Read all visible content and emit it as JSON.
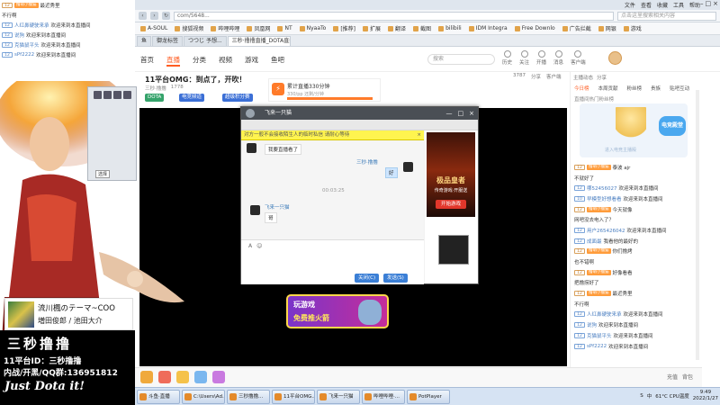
{
  "browser": {
    "menu": [
      "文件",
      "查看",
      "收藏",
      "工具",
      "帮助"
    ],
    "url": "com/5648...",
    "search_placeholder": "点击这里搜索相关内容",
    "bookmarks": [
      "A-SOUL",
      "搜狐视频",
      "哔哩哔哩",
      "凤凰网",
      "NT",
      "NyaaTo",
      "[推荐]",
      "扩展",
      "翻译",
      "截图",
      "bilibili",
      "IDM Integra",
      "Free Downlo",
      "广告拦截",
      "网银",
      "游戏"
    ],
    "tabs": [
      "鱼",
      "御龙标签",
      "つつじ 予想...",
      "三秒·撸撸直播_DOTA直播_斗..."
    ]
  },
  "site": {
    "nav": [
      "首页",
      "直播",
      "分类",
      "视频",
      "游戏",
      "鱼吧"
    ],
    "active_nav": "直播",
    "search_placeholder": "搜索",
    "header_icons": [
      "历史",
      "关注",
      "开播",
      "消息",
      "客户端"
    ]
  },
  "room": {
    "title": "11平台OMG：到点了，开吹！",
    "meta": [
      "三秒·撸撸",
      "1778"
    ],
    "buttons": [
      "DOTA",
      "电竞频道",
      "超级积分赛"
    ],
    "live_card": {
      "title": "累计直播330分钟",
      "sub": "330/pp 还剩/分钟"
    },
    "right_meta": [
      "3787",
      "分享",
      "客户端"
    ]
  },
  "chat_window": {
    "title": "飞来一只猫",
    "notice": "对方一般不会接收陌生人的临时私信 请耐心等待",
    "close_x": "×",
    "window_controls": [
      "—",
      "□",
      "×"
    ],
    "time": "00:03:25",
    "messages": [
      {
        "text": "我要直播看了",
        "mine": false
      },
      {
        "sender": "三秒·撸撸",
        "text": "好",
        "mine": true
      },
      {
        "sender": "飞来一只猫",
        "text": "哥",
        "mine": false
      }
    ],
    "input_tools": [
      "A",
      "☺"
    ],
    "btn_close": "关闭(C)",
    "btn_send": "发送(S)",
    "ad": {
      "title": "极品皇者",
      "subtitle": "传奇游戏·开服送",
      "cta": "开始游戏"
    }
  },
  "promo": {
    "line1": "玩游戏",
    "line2": "免费推火箭"
  },
  "right_panel": {
    "header": [
      "主播动态",
      "分享"
    ],
    "tabs": [
      "今日榜",
      "本周贡献",
      "粉丝榜",
      "贵族",
      "贴吧互动"
    ],
    "notice": "直播间热门粉丝榜",
    "banner_caption": "进入电竞主播殿",
    "banner_badge": "电竞殿堂",
    "chat": [
      {
        "lv": "12",
        "badge": "撸萌小撸猫",
        "user": "",
        "text": "泰波 ajr"
      },
      {
        "lv": "",
        "badge": "",
        "user": "",
        "text": "不就好了"
      },
      {
        "lv": "12",
        "badge": "",
        "user": "哪52456027",
        "text": "欢迎来到本直播间"
      },
      {
        "lv": "10",
        "badge": "",
        "user": "早模型好想看看",
        "text": "欢迎来到本直播间"
      },
      {
        "lv": "12",
        "badge": "撸萌小撸猫",
        "user": "",
        "text": "今天就像"
      },
      {
        "lv": "",
        "badge": "",
        "user": "",
        "text": "网吧没去电入了？"
      },
      {
        "lv": "12",
        "badge": "",
        "user": "用户265426042",
        "text": "欢迎来到本直播间"
      },
      {
        "lv": "12",
        "badge": "",
        "user": "成面最",
        "text": "我看他的最好的"
      },
      {
        "lv": "12",
        "badge": "撸萌小撸猫",
        "user": "",
        "text": "你们撸烤"
      },
      {
        "lv": "",
        "badge": "",
        "user": "",
        "text": "也不错啊"
      },
      {
        "lv": "12",
        "badge": "撸萌小撸猫",
        "user": "",
        "text": "好像看看"
      },
      {
        "lv": "",
        "badge": "",
        "user": "",
        "text": "把撸捞好了"
      },
      {
        "lv": "12",
        "badge": "撸萌小撸猫",
        "user": "",
        "text": "最近秀里"
      },
      {
        "lv": "",
        "badge": "",
        "user": "",
        "text": "不行啊"
      },
      {
        "lv": "12",
        "badge": "",
        "user": "人红鼻硬驶来承",
        "text": "欢迎来到本直播间"
      },
      {
        "lv": "12",
        "badge": "",
        "user": "说狗",
        "text": "欢迎来到本直播间"
      },
      {
        "lv": "12",
        "badge": "",
        "user": "克猫鼠平头",
        "text": "欢迎来到本直播间"
      },
      {
        "lv": "12",
        "badge": "",
        "user": "sPf2222",
        "text": "欢迎来到本直播间"
      }
    ]
  },
  "overlay": {
    "chat": [
      {
        "lv": "12",
        "badge": "撸萌小撸猫",
        "user": "",
        "text": "最近秀里"
      },
      {
        "lv": "",
        "badge": "",
        "user": "",
        "text": "不行啊"
      },
      {
        "lv": "12",
        "badge": "",
        "user": "人红鼻硬驶来承",
        "text": "欢迎来到本直播间"
      },
      {
        "lv": "12",
        "badge": "",
        "user": "说狗",
        "text": "欢迎来到本直播间"
      },
      {
        "lv": "12",
        "badge": "",
        "user": "克猫鼠平头",
        "text": "欢迎来到本直播间"
      },
      {
        "lv": "12",
        "badge": "",
        "user": "sPf2222",
        "text": "欢迎来到本直播间"
      }
    ],
    "panel_btn": "选择",
    "song": "流川楓のテーマ~COO",
    "artist": "増田俊郎 / 池田大介",
    "logo": "三秒撸撸",
    "platform_id": "11平台ID：三秒撸撸",
    "qq_group": "内战/开黑/QQ群:136951812",
    "slogan": "Just Dota it!"
  },
  "giftbar": {
    "right": [
      "充值",
      "背包"
    ]
  },
  "taskbar": {
    "items": [
      "斗鱼·直播",
      "C:\\Users\\Ad...",
      "三秒撸撸...",
      "11平台OMG...",
      "飞来一只猫",
      "哔哩哔哩·...",
      "PotPlayer"
    ],
    "clock_time": "9:49",
    "clock_date": "2022/1/27",
    "tray": [
      "S",
      "中",
      "61°C CPU温度"
    ]
  },
  "colors": {
    "accent": "#ff5d23",
    "chat_bar": "#4a4f55",
    "notice_yellow": "#fff44f"
  }
}
